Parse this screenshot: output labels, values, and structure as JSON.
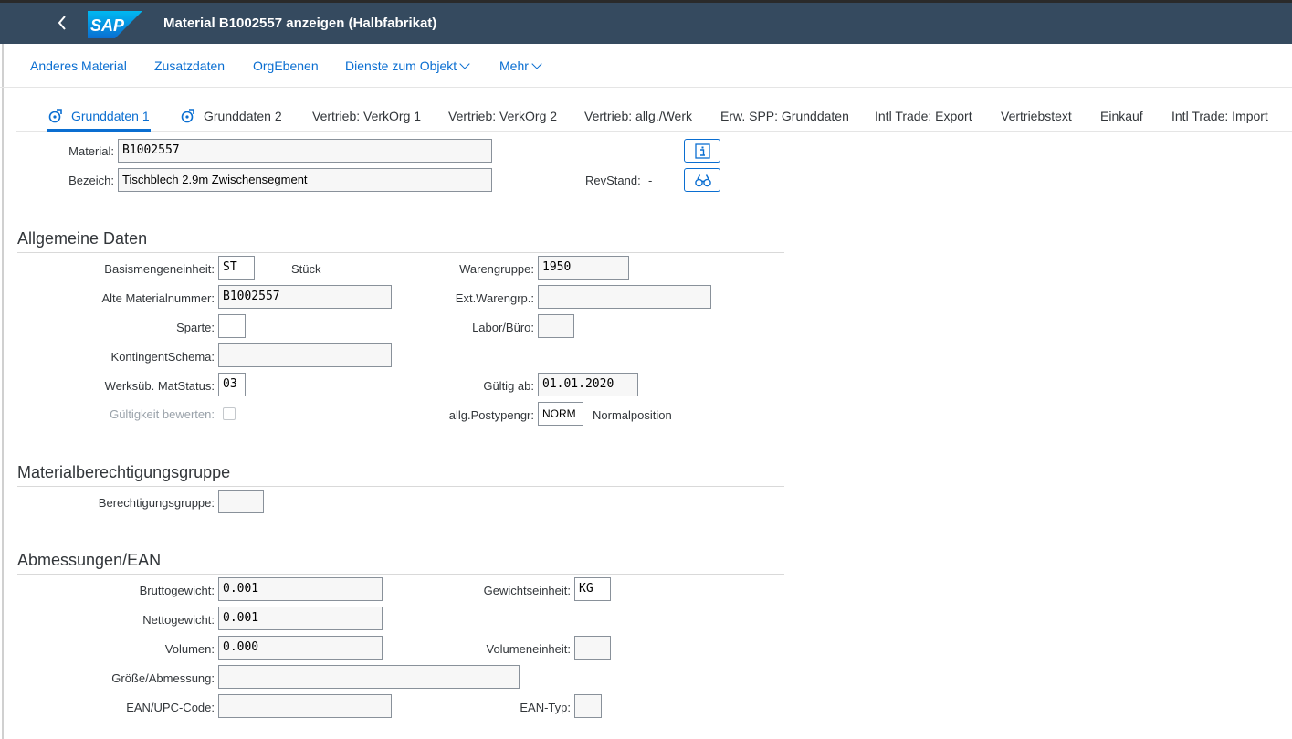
{
  "header": {
    "title": "Material B1002557 anzeigen (Halbfabrikat)",
    "logo_text": "SAP"
  },
  "toolbar": {
    "items": [
      "Anderes Material",
      "Zusatzdaten",
      "OrgEbenen",
      "Dienste zum Objekt",
      "Mehr"
    ]
  },
  "tabs": [
    "Grunddaten 1",
    "Grunddaten 2",
    "Vertrieb: VerkOrg 1",
    "Vertrieb: VerkOrg 2",
    "Vertrieb: allg./Werk",
    "Erw. SPP: Grunddaten",
    "Intl Trade: Export",
    "Vertriebstext",
    "Einkauf",
    "Intl Trade: Import"
  ],
  "active_tab": "Grunddaten 1",
  "top": {
    "material_label": "Material:",
    "material_value": "B1002557",
    "bezeich_label": "Bezeich:",
    "bezeich_value": "Tischblech 2.9m Zwischensegment",
    "revstand_label": "RevStand:",
    "revstand_value": "-"
  },
  "allgemeine": {
    "heading": "Allgemeine Daten",
    "basis_label": "Basismengeneinheit:",
    "basis_value": "ST",
    "basis_text": "Stück",
    "alte_label": "Alte Materialnummer:",
    "alte_value": "B1002557",
    "sparte_label": "Sparte:",
    "sparte_value": "",
    "kontingent_label": "KontingentSchema:",
    "kontingent_value": "",
    "werksueb_label": "Werksüb. MatStatus:",
    "werksueb_value": "03",
    "gueltigkeit_label": "Gültigkeit bewerten:",
    "warengruppe_label": "Warengruppe:",
    "warengruppe_value": "1950",
    "extwaren_label": "Ext.Warengrp.:",
    "extwaren_value": "",
    "labor_label": "Labor/Büro:",
    "labor_value": "",
    "gueltig_label": "Gültig ab:",
    "gueltig_value": "01.01.2020",
    "postyp_label": "allg.Postypengr:",
    "postyp_value": "NORM",
    "postyp_text": "Normalposition"
  },
  "berechtigung": {
    "heading": "Materialberechtigungsgruppe",
    "label": "Berechtigungsgruppe:",
    "value": ""
  },
  "abmessungen": {
    "heading": "Abmessungen/EAN",
    "brutto_label": "Bruttogewicht:",
    "brutto_value": "0.001",
    "netto_label": "Nettogewicht:",
    "netto_value": "0.001",
    "volumen_label": "Volumen:",
    "volumen_value": "0.000",
    "groesse_label": "Größe/Abmessung:",
    "groesse_value": "",
    "ean_label": "EAN/UPC-Code:",
    "ean_value": "",
    "gewicht_label": "Gewichtseinheit:",
    "gewicht_value": "KG",
    "voleinheit_label": "Volumeneinheit:",
    "voleinheit_value": "",
    "eantyp_label": "EAN-Typ:",
    "eantyp_value": ""
  }
}
